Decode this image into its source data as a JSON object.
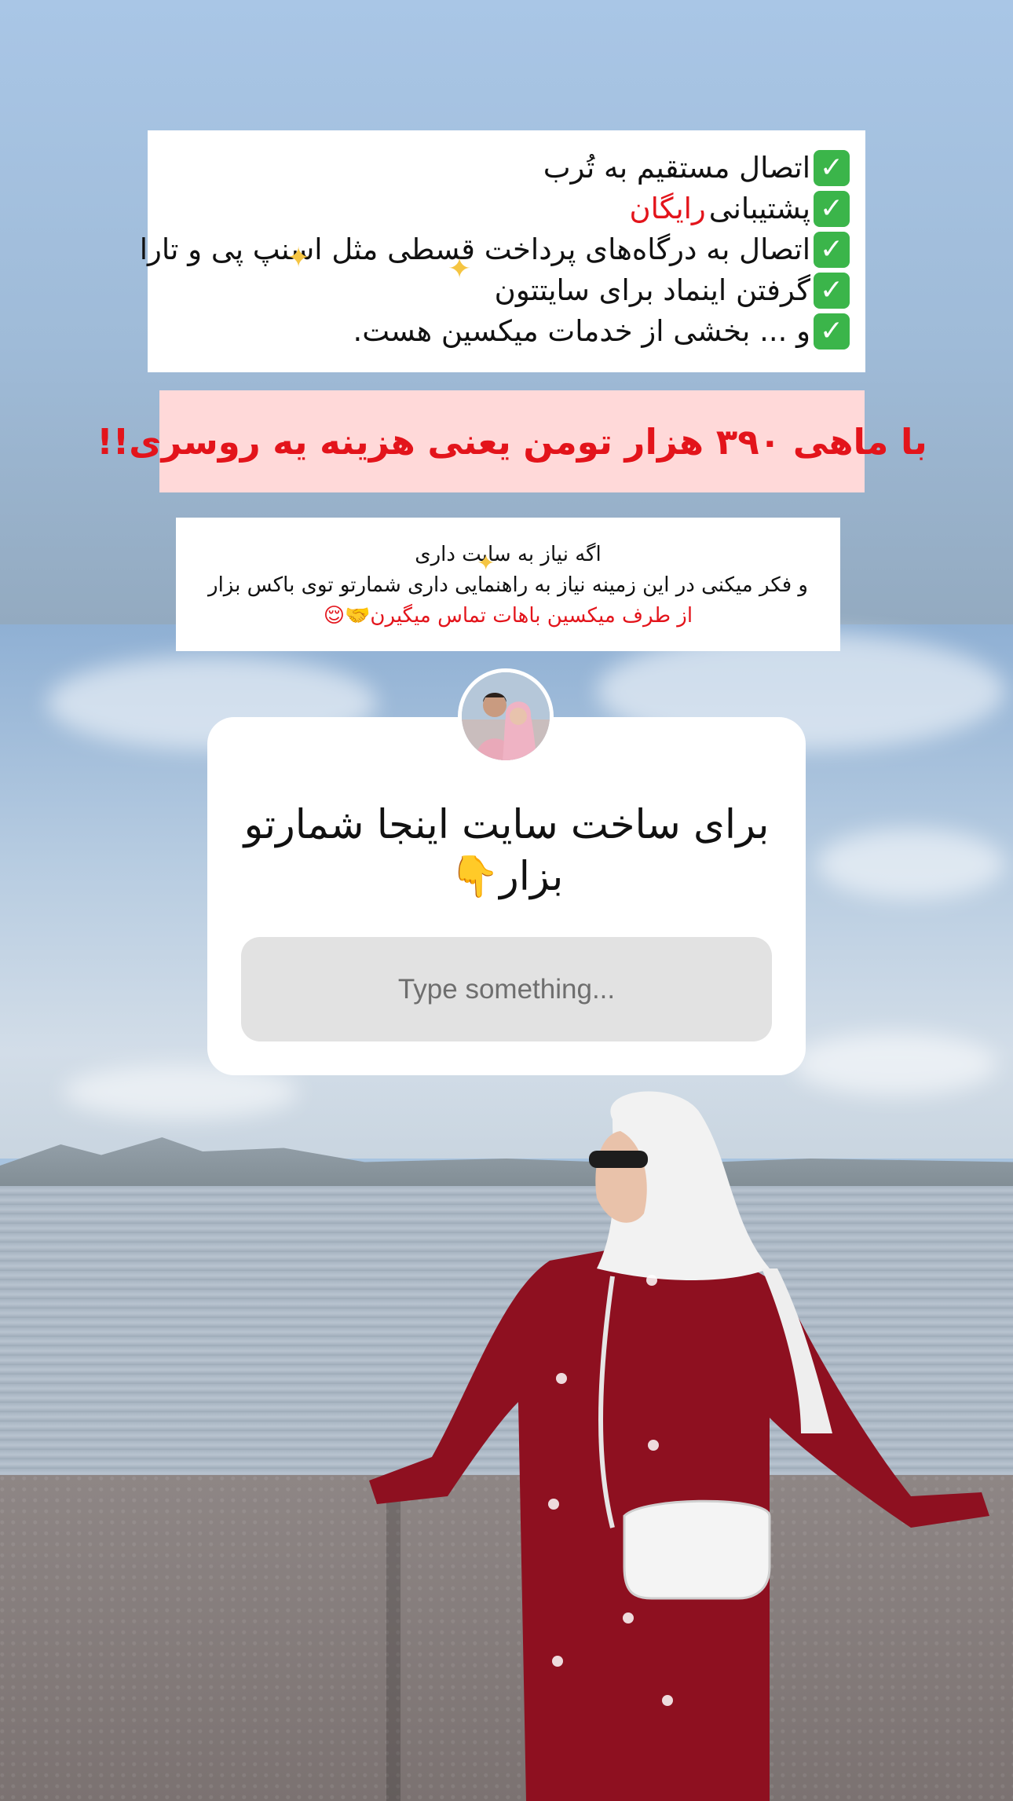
{
  "box1": {
    "lines": [
      {
        "text": "اتصال مستقیم به تُرب",
        "highlight": ""
      },
      {
        "text": "پشتیبانی ",
        "highlight": "رایگان"
      },
      {
        "text": "اتصال به درگاه‌های پرداخت قسطی مثل اسنپ پی و تارا",
        "highlight": ""
      },
      {
        "text": "گرفتن اینماد برای سایتتون",
        "highlight": ""
      },
      {
        "text": "و ... بخشی از خدمات میکسین هست.",
        "highlight": ""
      }
    ]
  },
  "box2": {
    "text": "با ماهی ۳۹۰ هزار تومن یعنی هزینه یه روسری!!"
  },
  "box3": {
    "line1": "اگه نیاز به سایت داری",
    "line2": "و فکر میکنی در این زمینه نیاز به راهنمایی داری شمارتو توی  باکس بزار",
    "line3": "از طرف میکسین باهات تماس میگیرن🤝😌"
  },
  "question_sticker": {
    "question": "برای ساخت سایت اینجا شمارتو بزار👇",
    "placeholder": "Type something..."
  },
  "icons": {
    "check": "check-mark-icon",
    "sparkle": "sparkle-icon"
  },
  "colors": {
    "check_green": "#3bb54a",
    "highlight_red": "#e3141b",
    "banner_pink": "#ffd9d9"
  }
}
